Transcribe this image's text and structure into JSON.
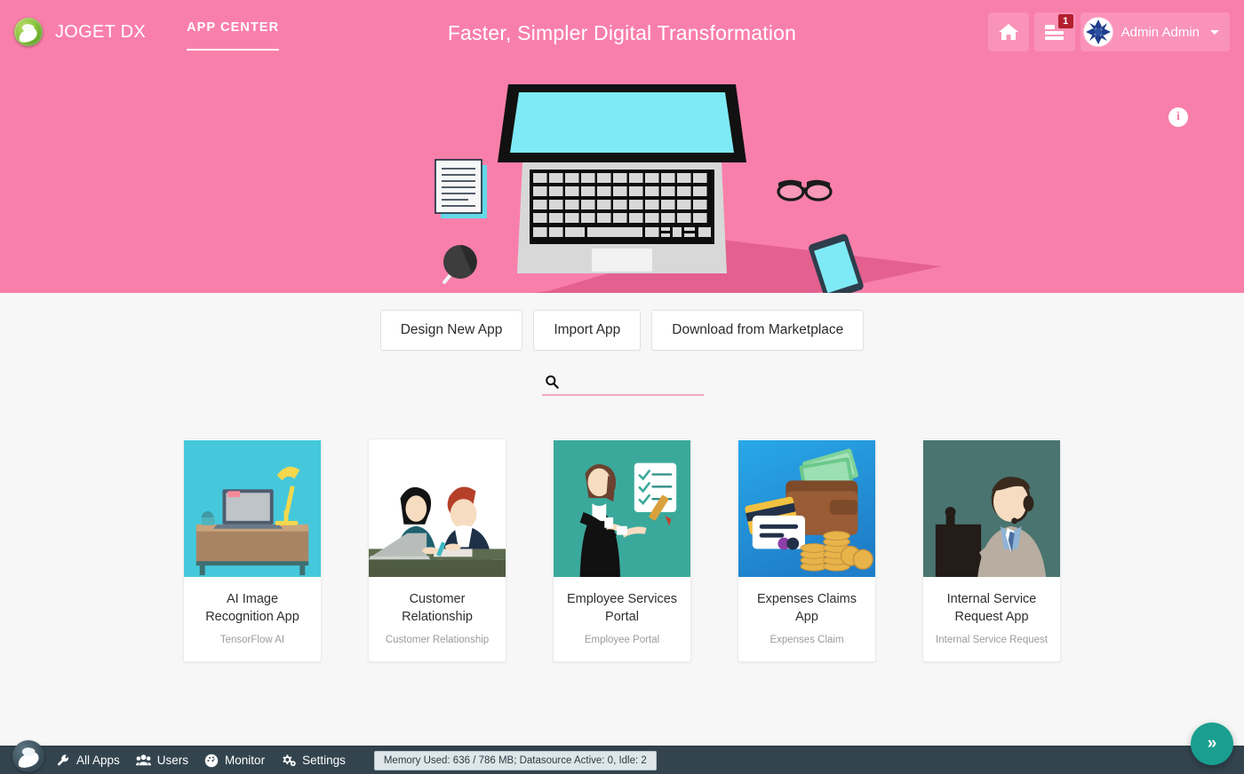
{
  "header": {
    "brand_name": "JOGET DX",
    "logo_icon": "joget-leaf-logo",
    "nav_tab": "APP CENTER",
    "tagline": "Faster, Simpler Digital Transformation",
    "home_icon": "home-icon",
    "notifications_icon": "list-lines-icon",
    "notifications_badge": "1",
    "avatar_icon": "user-avatar-identicon",
    "user_name": "Admin Admin",
    "caret_icon": "chevron-down-icon",
    "info_icon": "info-circle-icon",
    "info_glyph": "i"
  },
  "hero": {
    "background_color": "#f97fab",
    "shadow_color": "#e4608f",
    "screen_color": "#7eeaf5",
    "illustration": "laptop-desk-flat-illustration"
  },
  "actions": [
    {
      "label": "Design New App",
      "name": "design-new-app-button"
    },
    {
      "label": "Import App",
      "name": "import-app-button"
    },
    {
      "label": "Download from Marketplace",
      "name": "download-from-marketplace-button"
    }
  ],
  "search": {
    "icon": "search-icon",
    "value": "",
    "placeholder": "",
    "underline_color": "#f4a8c2"
  },
  "apps": [
    {
      "title": "AI Image Recognition App",
      "subtitle": "TensorFlow AI",
      "art": "desk-lamp-laptop-illustration",
      "bg": "#45c8dc"
    },
    {
      "title": "Customer Relationship",
      "subtitle": "Customer Relationship",
      "art": "two-people-meeting-illustration",
      "bg": "#ffffff"
    },
    {
      "title": "Employee Services Portal",
      "subtitle": "Employee Portal",
      "art": "businesswoman-checklist-illustration",
      "bg": "#3aa99b"
    },
    {
      "title": "Expenses Claims App",
      "subtitle": "Expenses Claim",
      "art": "wallet-money-coins-illustration",
      "bg": "#2196dd"
    },
    {
      "title": "Internal Service Request App",
      "subtitle": "Internal Service Request",
      "art": "call-center-agent-illustration",
      "bg": "#4a7470"
    }
  ],
  "footer": {
    "logo_icon": "joget-leaf-logo",
    "nav": [
      {
        "label": "All Apps",
        "icon": "wrench-icon",
        "name": "footer-all-apps"
      },
      {
        "label": "Users",
        "icon": "users-icon",
        "name": "footer-users"
      },
      {
        "label": "Monitor",
        "icon": "gauge-icon",
        "name": "footer-monitor"
      },
      {
        "label": "Settings",
        "icon": "gears-icon",
        "name": "footer-settings"
      }
    ],
    "memory_status": "Memory Used: 636 / 786 MB; Datasource Active: 0, Idle: 2",
    "fab_icon": "double-chevron-right-icon",
    "fab_glyph": "»",
    "fab_color": "#1a9e90"
  }
}
